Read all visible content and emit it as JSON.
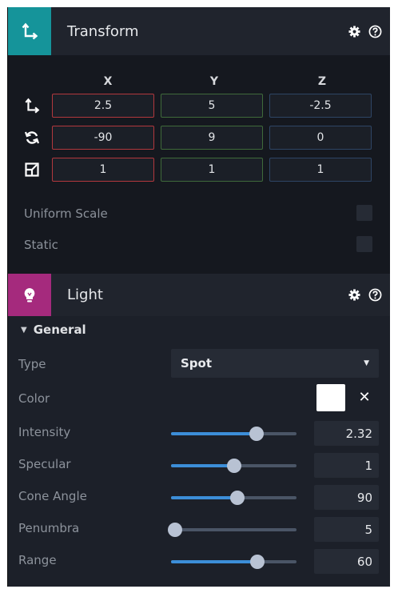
{
  "transform": {
    "title": "Transform",
    "icon": "move-axes-icon",
    "axes": [
      "X",
      "Y",
      "Z"
    ],
    "position": [
      "2.5",
      "5",
      "-2.5"
    ],
    "rotation": [
      "-90",
      "9",
      "0"
    ],
    "scale": [
      "1",
      "1",
      "1"
    ],
    "uniform_scale_label": "Uniform Scale",
    "static_label": "Static",
    "accent": "#15949a"
  },
  "light": {
    "title": "Light",
    "icon": "lightbulb-icon",
    "accent": "#a52a7d",
    "section": "General",
    "type_label": "Type",
    "type_value": "Spot",
    "color_label": "Color",
    "color_value": "#ffffff",
    "properties": [
      {
        "label": "Intensity",
        "value": "2.32",
        "slider_fraction": 0.68
      },
      {
        "label": "Specular",
        "value": "1",
        "slider_fraction": 0.5
      },
      {
        "label": "Cone Angle",
        "value": "90",
        "slider_fraction": 0.53
      },
      {
        "label": "Penumbra",
        "value": "5",
        "slider_fraction": 0.0
      },
      {
        "label": "Range",
        "value": "60",
        "slider_fraction": 0.69
      }
    ]
  }
}
